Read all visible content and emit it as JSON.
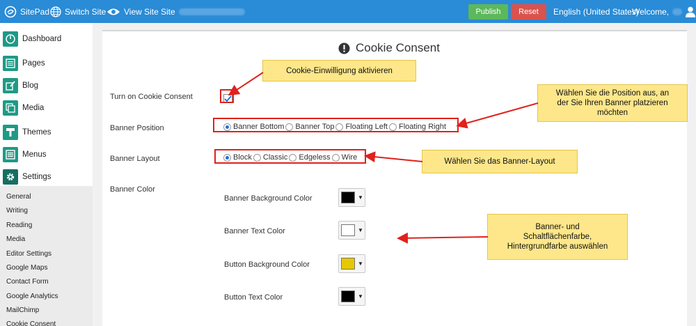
{
  "topbar": {
    "brand": "SitePad",
    "switch_site": "Switch Site",
    "view_site": "View Site",
    "site_label": "Site",
    "publish": "Publish",
    "reset": "Reset",
    "language": "English (United States)",
    "welcome": "Welcome,"
  },
  "sidebar": {
    "items": [
      {
        "label": "Dashboard",
        "icon": "dashboard-icon"
      },
      {
        "label": "Pages",
        "icon": "pages-icon"
      },
      {
        "label": "Blog",
        "icon": "blog-icon"
      },
      {
        "label": "Media",
        "icon": "media-icon"
      },
      {
        "label": "Themes",
        "icon": "themes-icon"
      },
      {
        "label": "Menus",
        "icon": "menus-icon"
      },
      {
        "label": "Settings",
        "icon": "gear-icon"
      }
    ],
    "sub_items": [
      "General",
      "Writing",
      "Reading",
      "Media",
      "Editor Settings",
      "Google Maps",
      "Contact Form",
      "Google Analytics",
      "MailChimp",
      "Cookie Consent"
    ]
  },
  "main": {
    "title": "Cookie Consent",
    "turn_on_label": "Turn on Cookie Consent",
    "turn_on_checked": true,
    "banner_position": {
      "label": "Banner Position",
      "options": [
        "Banner Bottom",
        "Banner Top",
        "Floating Left",
        "Floating Right"
      ],
      "selected": "Banner Bottom"
    },
    "banner_layout": {
      "label": "Banner Layout",
      "options": [
        "Block",
        "Classic",
        "Edgeless",
        "Wire"
      ],
      "selected": "Block"
    },
    "banner_color": {
      "label": "Banner Color",
      "colors": [
        {
          "label": "Banner Background Color",
          "value": "#000000"
        },
        {
          "label": "Banner Text Color",
          "value": "#ffffff"
        },
        {
          "label": "Button Background Color",
          "value": "#e6c800"
        },
        {
          "label": "Button Text Color",
          "value": "#000000"
        }
      ]
    }
  },
  "annotations": {
    "note1": "Cookie-Einwilligung aktivieren",
    "note2_line1": "Wählen Sie die Position aus, an",
    "note2_line2": "der Sie Ihren Banner platzieren",
    "note2_line3": "möchten",
    "note3": "Wählen Sie das Banner-Layout",
    "note4_line1": "Banner- und",
    "note4_line2": "Schaltflächenfarbe,",
    "note4_line3": "Hintergrundfarbe auswählen"
  },
  "colors": {
    "topbar": "#2a8bd6",
    "accent": "#1e9a86",
    "publish": "#5cb85c",
    "reset": "#d9534f",
    "highlight": "#e0211c",
    "note_bg": "#fde78a"
  }
}
